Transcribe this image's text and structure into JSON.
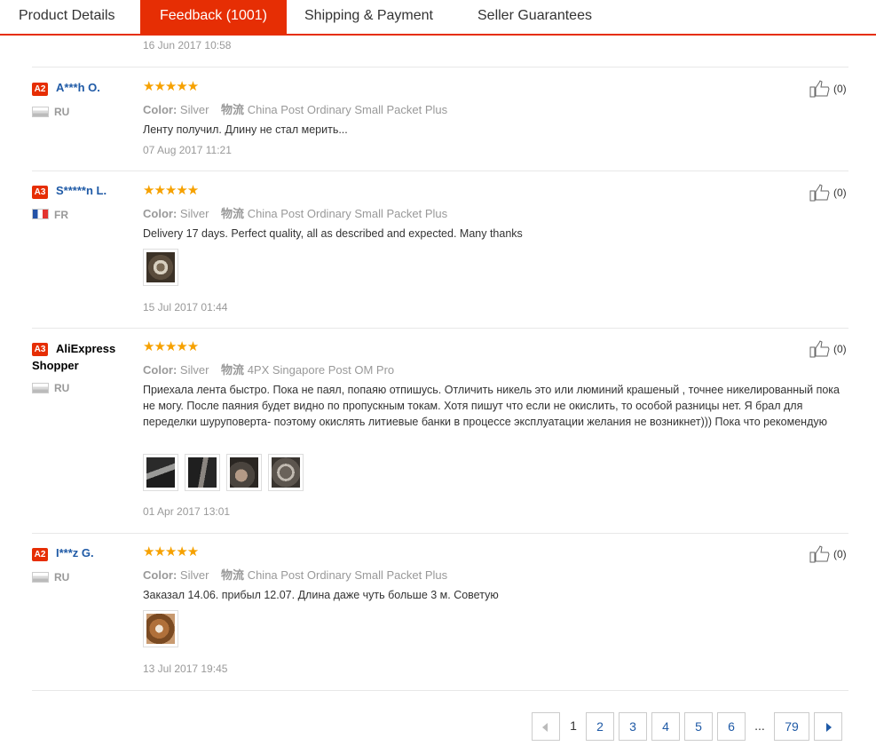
{
  "tabs": [
    {
      "label": "Product Details"
    },
    {
      "label": "Feedback (1001)"
    },
    {
      "label": "Shipping & Payment"
    },
    {
      "label": "Seller Guarantees"
    }
  ],
  "first_date": "16 Jun 2017 10:58",
  "reviews": [
    {
      "badge": "A2",
      "name": "A***h O.",
      "country": "RU",
      "stars": "★★★★★",
      "color_key": "Color:",
      "color_val": "Silver",
      "logistics_key": "物流",
      "logistics_val": "China Post Ordinary Small Packet Plus",
      "text": "Ленту получил. Длину не стал мерить...",
      "date": "07 Aug 2017 11:21",
      "helpful": "(0)"
    },
    {
      "badge": "A3",
      "name": "S*****n L.",
      "country": "FR",
      "stars": "★★★★★",
      "color_key": "Color:",
      "color_val": "Silver",
      "logistics_key": "物流",
      "logistics_val": "China Post Ordinary Small Packet Plus",
      "text": "Delivery 17 days. Perfect quality, all as described and expected. Many thanks",
      "date": "15 Jul 2017 01:44",
      "helpful": "(0)"
    },
    {
      "badge": "A3",
      "name": "AliExpress Shopper",
      "country": "RU",
      "stars": "★★★★★",
      "color_key": "Color:",
      "color_val": "Silver",
      "logistics_key": "物流",
      "logistics_val": "4PX Singapore Post OM Pro",
      "text": "Приехала лента быстро. Пока не паял, попаяю отпишусь. Отличить никель это или люминий крашеный , точнее никелированный пока не могу. После паяния будет видно по пропускным токам. Хотя пишут что если не окислить, то особой разницы нет. Я брал для переделки шуруповерта- поэтому окислять литиевые банки в процессе эксплуатации желания не возникнет))) Пока что рекомендую",
      "date": "01 Apr 2017 13:01",
      "helpful": "(0)"
    },
    {
      "badge": "A2",
      "name": "I***z G.",
      "country": "RU",
      "stars": "★★★★★",
      "color_key": "Color:",
      "color_val": "Silver",
      "logistics_key": "物流",
      "logistics_val": "China Post Ordinary Small Packet Plus",
      "text": "Заказал 14.06. прибыл 12.07. Длина даже чуть больше 3 м. Советую",
      "date": "13 Jul 2017 19:45",
      "helpful": "(0)"
    }
  ],
  "pagination": {
    "pages": [
      "1",
      "2",
      "3",
      "4",
      "5",
      "6",
      "...",
      "79"
    ],
    "current": "1"
  }
}
